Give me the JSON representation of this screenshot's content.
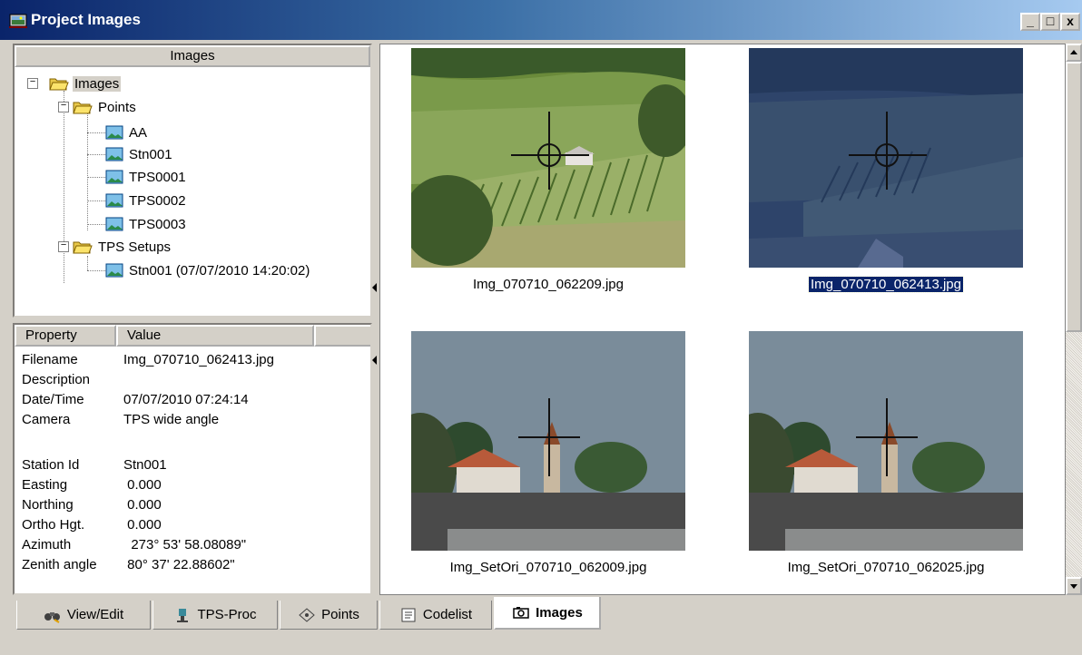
{
  "window": {
    "title": "Project Images",
    "minimize_label": "_",
    "maximize_label": "□",
    "close_label": "x"
  },
  "tree": {
    "header": "Images",
    "root": "Images",
    "points_folder": "Points",
    "points": [
      "AA",
      "Stn001",
      "TPS0001",
      "TPS0002",
      "TPS0003"
    ],
    "setups_folder": "TPS Setups",
    "setups": [
      "Stn001 (07/07/2010 14:20:02)"
    ]
  },
  "properties": {
    "col_property": "Property",
    "col_value": "Value",
    "rows": [
      {
        "name": "Filename",
        "value": "Img_070710_062413.jpg"
      },
      {
        "name": "Description",
        "value": ""
      },
      {
        "name": "Date/Time",
        "value": "07/07/2010 07:24:14"
      },
      {
        "name": "Camera",
        "value": "TPS wide angle"
      },
      {
        "name": "",
        "value": ""
      },
      {
        "name": "Station Id",
        "value": "Stn001"
      },
      {
        "name": "Easting",
        "value": " 0.000"
      },
      {
        "name": "Northing",
        "value": " 0.000"
      },
      {
        "name": "Ortho Hgt.",
        "value": " 0.000"
      },
      {
        "name": "Azimuth",
        "value": "  273° 53' 58.08089\""
      },
      {
        "name": "Zenith angle",
        "value": " 80° 37' 22.88602\""
      }
    ]
  },
  "images": [
    {
      "filename": "Img_070710_062209.jpg",
      "selected": false
    },
    {
      "filename": "Img_070710_062413.jpg",
      "selected": true
    },
    {
      "filename": "Img_SetOri_070710_062009.jpg",
      "selected": false
    },
    {
      "filename": "Img_SetOri_070710_062025.jpg",
      "selected": false
    }
  ],
  "tabs": [
    {
      "label": "View/Edit",
      "icon": "binoculars-icon",
      "active": false
    },
    {
      "label": "TPS-Proc",
      "icon": "tps-instrument-icon",
      "active": false
    },
    {
      "label": "Points",
      "icon": "points-icon",
      "active": false
    },
    {
      "label": "Codelist",
      "icon": "codelist-icon",
      "active": false
    },
    {
      "label": "Images",
      "icon": "camera-icon",
      "active": true
    }
  ],
  "colors": {
    "title_start": "#0a246a",
    "title_end": "#a6caf0",
    "selection": "#0a246a",
    "face": "#d4d0c8"
  }
}
